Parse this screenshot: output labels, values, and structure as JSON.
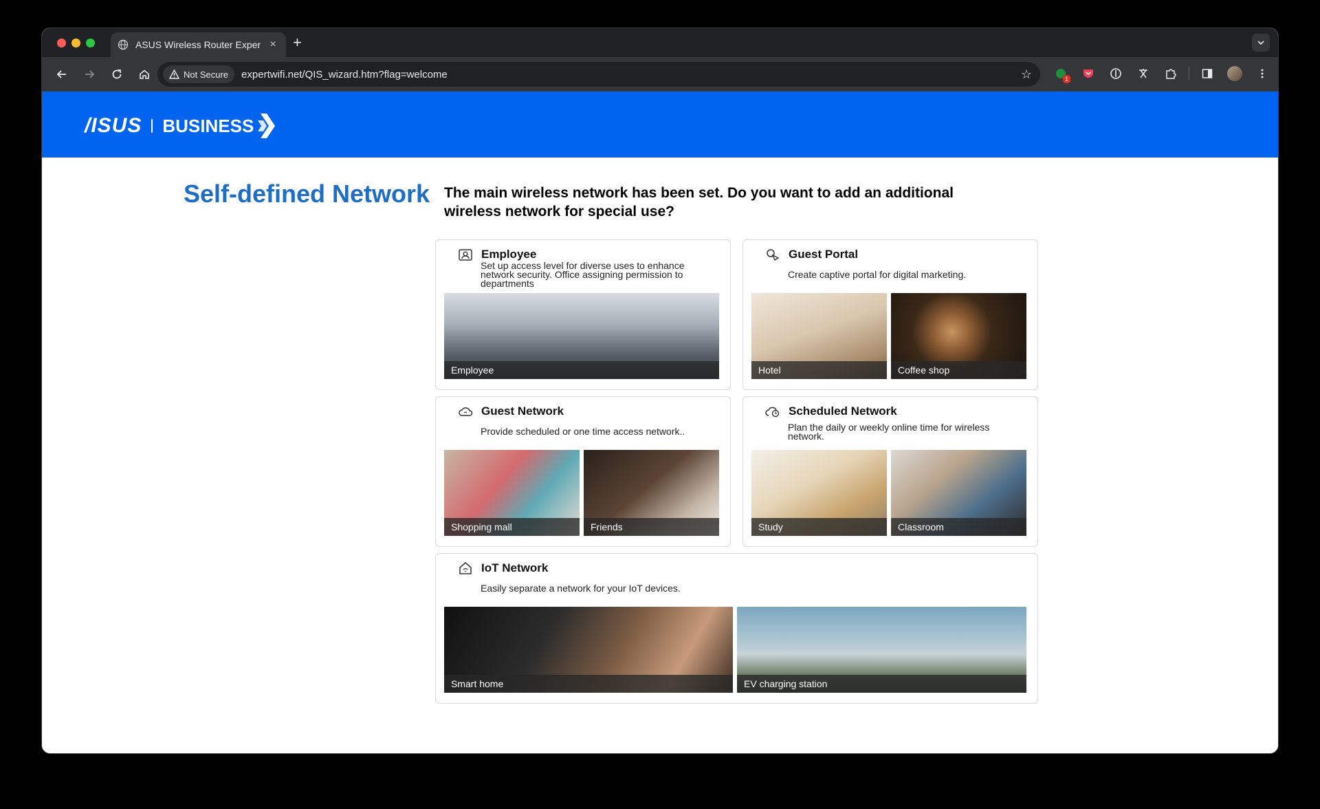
{
  "browser": {
    "tab_title": "ASUS Wireless Router Exper",
    "tab_close": "×",
    "new_tab": "+",
    "security_chip": "Not Secure",
    "url": "expertwifi.net/QIS_wizard.htm?flag=welcome",
    "extension_badge": "1"
  },
  "header": {
    "logo_asus": "/ISUS",
    "logo_business": "BUSINESS"
  },
  "main": {
    "title": "Self-defined Network",
    "question": "The main wireless network has been set. Do you want to add an additional wireless network for special use?"
  },
  "cards": {
    "employee": {
      "title": "Employee",
      "desc": "Set up access level for diverse uses to enhance network security. Office assigning permission to departments",
      "photos": [
        "Employee"
      ]
    },
    "guest_portal": {
      "title": "Guest Portal",
      "desc": "Create captive portal for digital marketing.",
      "photos": [
        "Hotel",
        "Coffee shop"
      ]
    },
    "guest_network": {
      "title": "Guest Network",
      "desc": "Provide scheduled or one time access network..",
      "photos": [
        "Shopping mall",
        "Friends"
      ]
    },
    "scheduled_network": {
      "title": "Scheduled Network",
      "desc": "Plan the daily or weekly online time for wireless network.",
      "photos": [
        "Study",
        "Classroom"
      ]
    },
    "iot_network": {
      "title": "IoT Network",
      "desc": "Easily separate a network for your IoT devices.",
      "photos": [
        "Smart home",
        "EV charging station"
      ]
    }
  }
}
